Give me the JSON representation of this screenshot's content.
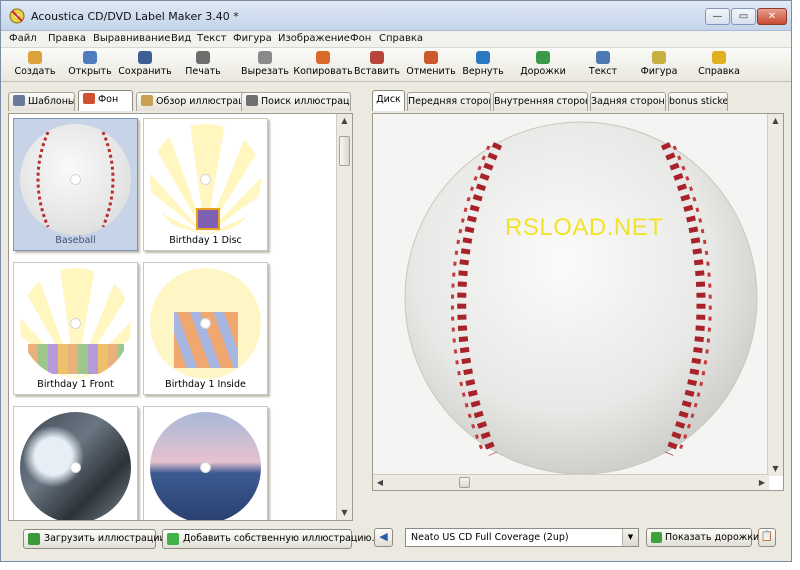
{
  "window": {
    "title": "Acoustica CD/DVD Label Maker 3.40 *",
    "min_glyph": "—",
    "max_glyph": "▭",
    "close_glyph": "✕"
  },
  "menu": [
    "Файл",
    "Правка",
    "Выравнивание",
    "Вид",
    "Текст",
    "Фигура",
    "Изображение",
    "Фон",
    "Справка"
  ],
  "toolbar": [
    {
      "label": "Создать",
      "icon": "new-icon",
      "color": "#d9a23a"
    },
    {
      "label": "Открыть",
      "icon": "open-icon",
      "color": "#4c7dc0"
    },
    {
      "label": "Сохранить",
      "icon": "save-icon",
      "color": "#3d5f96"
    },
    {
      "label": "Печать",
      "icon": "print-icon",
      "color": "#6d6d6d"
    },
    {
      "label": "Вырезать",
      "icon": "cut-icon",
      "color": "#8a8a8a"
    },
    {
      "label": "Копировать",
      "icon": "copy-icon",
      "color": "#d96a2a"
    },
    {
      "label": "Вставить",
      "icon": "paste-icon",
      "color": "#b8443a"
    },
    {
      "label": "Отменить",
      "icon": "undo-icon",
      "color": "#cc5a2a"
    },
    {
      "label": "Вернуть",
      "icon": "redo-icon",
      "color": "#2a78c0"
    },
    {
      "label": "Дорожки",
      "icon": "tracks-icon",
      "color": "#3a9a4a"
    },
    {
      "label": "Текст",
      "icon": "text-icon",
      "color": "#4a7ab0"
    },
    {
      "label": "Фигура",
      "icon": "shape-icon",
      "color": "#c8b040"
    },
    {
      "label": "Справка",
      "icon": "help-icon",
      "color": "#e0b020"
    }
  ],
  "left_tabs": [
    {
      "label": "Шаблоны",
      "icon": "templates-icon",
      "color": "#6a7a9a"
    },
    {
      "label": "Фон",
      "icon": "background-icon",
      "color": "#d05030"
    },
    {
      "label": "Обзор иллюстраций",
      "icon": "browse-illustrations-icon",
      "color": "#c8a050"
    },
    {
      "label": "Поиск иллюстраций",
      "icon": "search-illustrations-icon",
      "color": "#707070"
    }
  ],
  "gallery": [
    {
      "caption": "Baseball",
      "selected": true
    },
    {
      "caption": "Birthday 1 Disc",
      "selected": false
    },
    {
      "caption": "Birthday 1 Front",
      "selected": false
    },
    {
      "caption": "Birthday 1 Inside",
      "selected": false
    },
    {
      "caption": "",
      "selected": false
    },
    {
      "caption": "",
      "selected": false
    }
  ],
  "left_buttons": {
    "load": "Загрузить иллюстрации...",
    "add_own": "Добавить собственную иллюстрацию..."
  },
  "right_tabs": [
    "Диск",
    "Передняя сторона",
    "Внутренняя сторона",
    "Задняя сторона",
    "bonus sticker"
  ],
  "canvas": {
    "watermark": "RSLOAD.NET"
  },
  "bottom": {
    "label_type": "Neato US CD Full Coverage (2up)",
    "show_tracks": "Показать дорожки"
  },
  "scroll_glyphs": {
    "up": "▲",
    "down": "▼",
    "left": "◀",
    "right": "▶",
    "dropdown": "▼",
    "nav_left": "◀",
    "clip": "📋"
  }
}
